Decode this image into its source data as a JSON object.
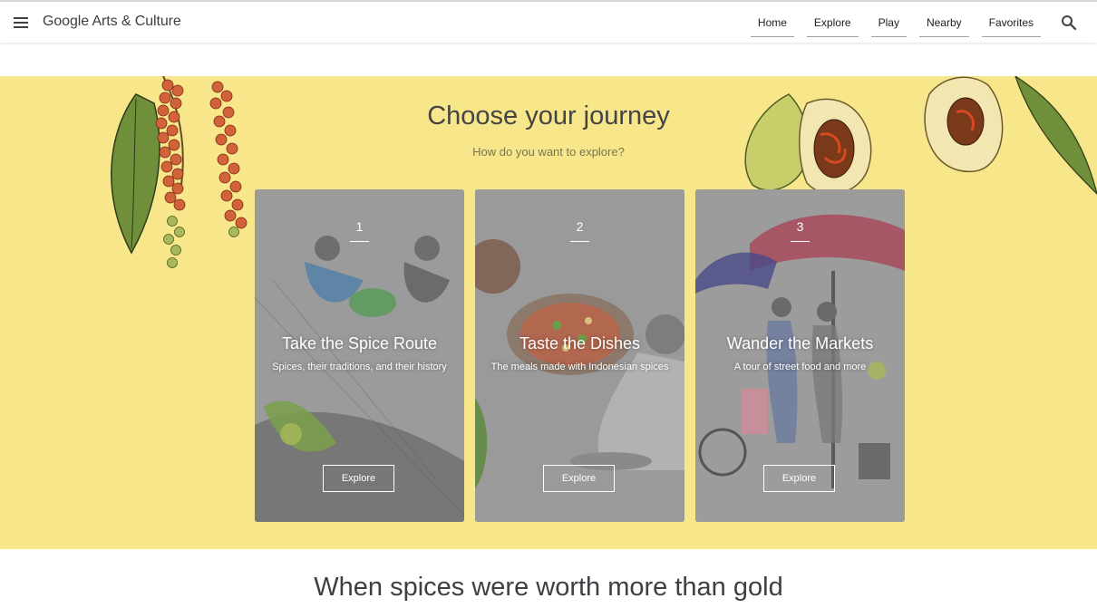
{
  "header": {
    "logo": "Google Arts & Culture",
    "nav": [
      "Home",
      "Explore",
      "Play",
      "Nearby",
      "Favorites"
    ]
  },
  "hero": {
    "title": "Choose your journey",
    "subtitle": "How do you want to explore?",
    "background": "#f7e68a"
  },
  "cards": [
    {
      "number": "1",
      "title": "Take the Spice Route",
      "subtitle": "Spices, their traditions, and their history",
      "button": "Explore"
    },
    {
      "number": "2",
      "title": "Taste the Dishes",
      "subtitle": "The meals made with Indonesian spices",
      "button": "Explore"
    },
    {
      "number": "3",
      "title": "Wander the Markets",
      "subtitle": "A tour of street food and more",
      "button": "Explore"
    }
  ],
  "section": {
    "title": "When spices were worth more than gold"
  },
  "icons": {
    "menu": "menu-icon",
    "search": "search-icon"
  }
}
